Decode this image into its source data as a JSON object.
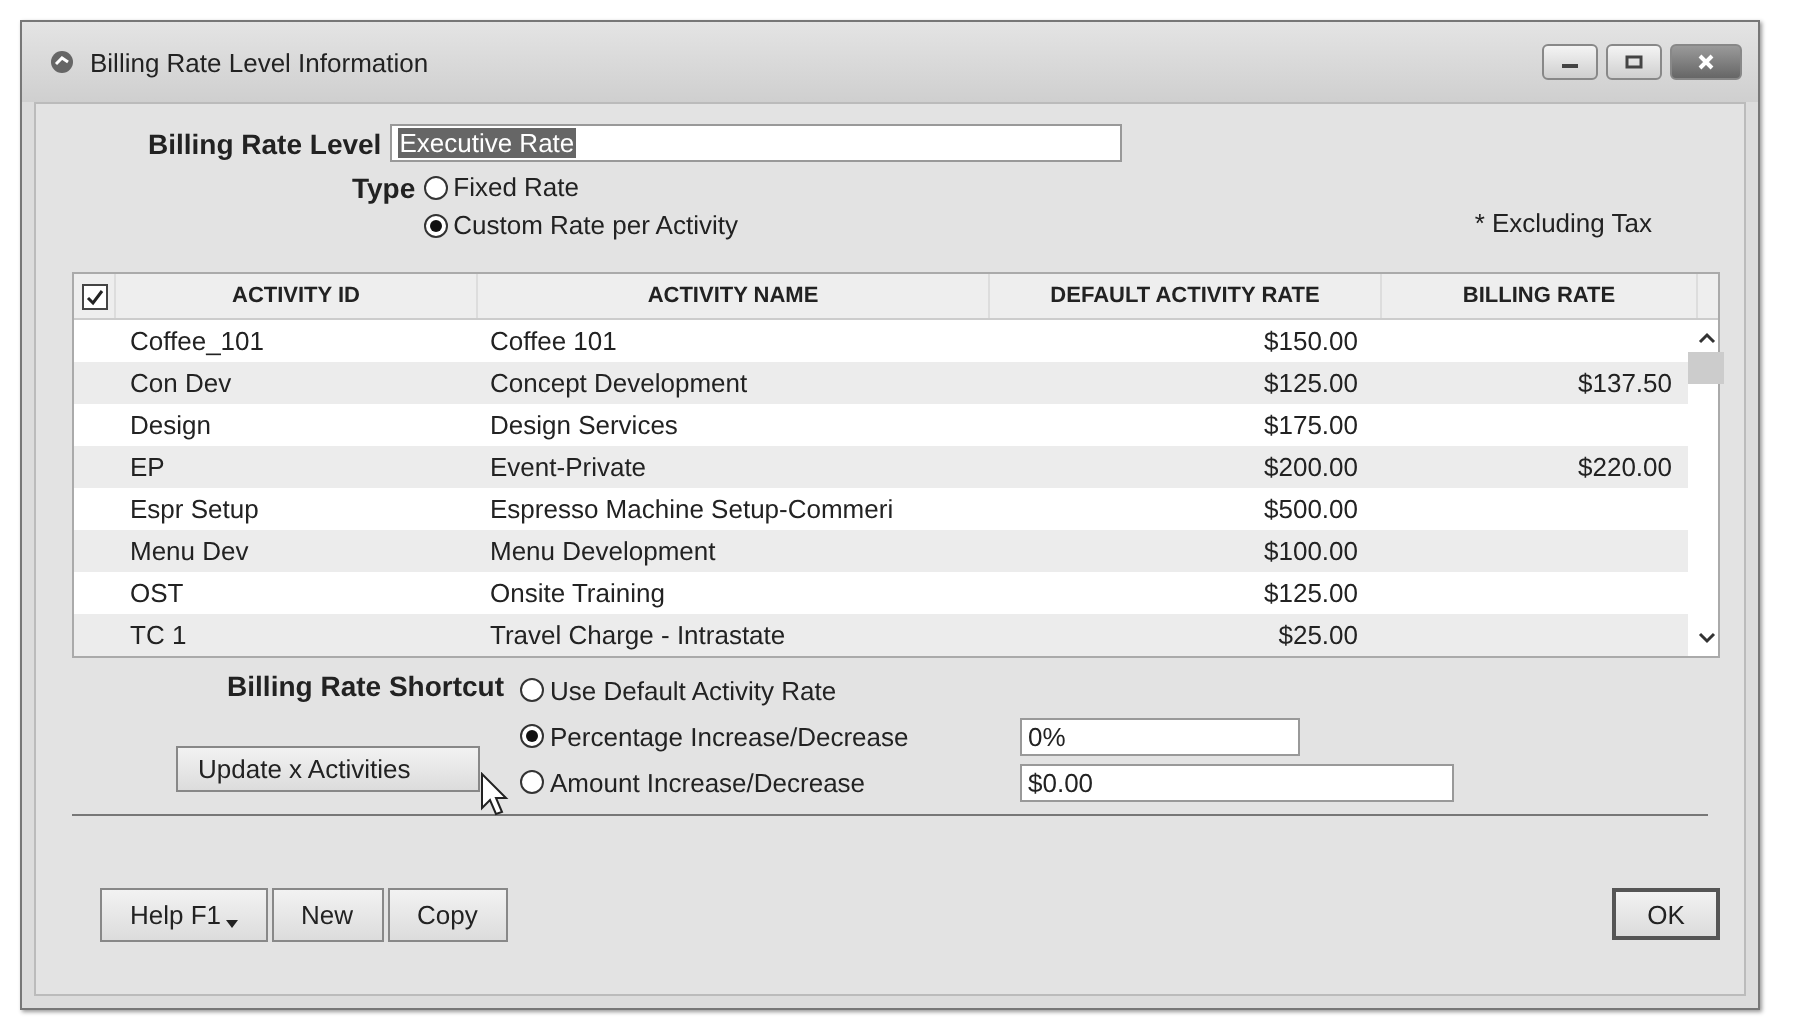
{
  "window": {
    "title": "Billing Rate Level Information"
  },
  "billing_rate_level": {
    "label": "Billing Rate Level",
    "value": "Executive Rate"
  },
  "type": {
    "label": "Type",
    "options": [
      {
        "label": "Fixed Rate",
        "selected": false
      },
      {
        "label": "Custom Rate per Activity",
        "selected": true
      }
    ]
  },
  "note": "* Excluding Tax",
  "table": {
    "select_all_checked": true,
    "columns": [
      "ACTIVITY ID",
      "ACTIVITY NAME",
      "DEFAULT ACTIVITY RATE",
      "BILLING RATE"
    ],
    "rows": [
      {
        "id": "Coffee_101",
        "name": "Coffee 101",
        "default_rate": "$150.00",
        "billing_rate": ""
      },
      {
        "id": "Con Dev",
        "name": "Concept Development",
        "default_rate": "$125.00",
        "billing_rate": "$137.50"
      },
      {
        "id": "Design",
        "name": "Design Services",
        "default_rate": "$175.00",
        "billing_rate": ""
      },
      {
        "id": "EP",
        "name": "Event-Private",
        "default_rate": "$200.00",
        "billing_rate": "$220.00"
      },
      {
        "id": "Espr Setup",
        "name": "Espresso Machine Setup-Commeri",
        "default_rate": "$500.00",
        "billing_rate": ""
      },
      {
        "id": "Menu Dev",
        "name": "Menu Development",
        "default_rate": "$100.00",
        "billing_rate": ""
      },
      {
        "id": "OST",
        "name": "Onsite Training",
        "default_rate": "$125.00",
        "billing_rate": ""
      },
      {
        "id": "TC 1",
        "name": "Travel Charge - Intrastate",
        "default_rate": "$25.00",
        "billing_rate": ""
      }
    ]
  },
  "shortcut": {
    "label": "Billing Rate Shortcut",
    "options": [
      {
        "label": "Use Default Activity Rate",
        "selected": false
      },
      {
        "label": "Percentage Increase/Decrease",
        "selected": true,
        "value": "0%"
      },
      {
        "label": "Amount Increase/Decrease",
        "selected": false,
        "value": "$0.00"
      }
    ],
    "update_button": "Update x Activities"
  },
  "footer_buttons": [
    {
      "label": "Help F1",
      "kind": "menu"
    },
    {
      "label": "New",
      "kind": "plain"
    },
    {
      "label": "Copy",
      "kind": "plain"
    }
  ],
  "ok_button": "OK"
}
